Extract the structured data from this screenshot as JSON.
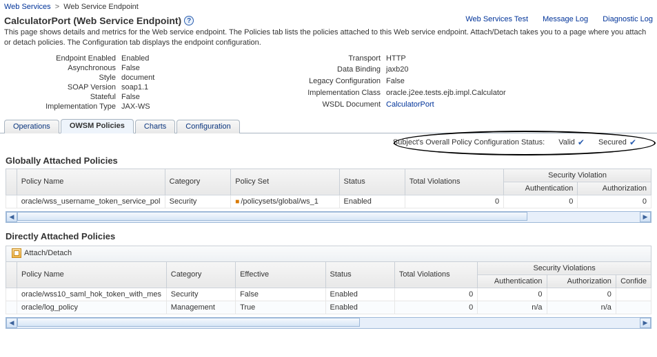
{
  "breadcrumb": {
    "root": "Web Services",
    "current": "Web Service Endpoint"
  },
  "title": "CalculatorPort (Web Service Endpoint)",
  "actions": {
    "test": "Web Services Test",
    "log": "Message Log",
    "diag": "Diagnostic Log"
  },
  "description": "This page shows details and metrics for the Web service endpoint. The Policies tab lists the policies attached to this Web service endpoint. Attach/Detach takes you to a page where you attach or detach policies. The Configuration tab displays the endpoint configuration.",
  "props_left": {
    "endpoint_enabled": {
      "label": "Endpoint Enabled",
      "value": "Enabled"
    },
    "asynchronous": {
      "label": "Asynchronous",
      "value": "False"
    },
    "style": {
      "label": "Style",
      "value": "document"
    },
    "soap_version": {
      "label": "SOAP Version",
      "value": "soap1.1"
    },
    "stateful": {
      "label": "Stateful",
      "value": "False"
    },
    "impl_type": {
      "label": "Implementation Type",
      "value": "JAX-WS"
    }
  },
  "props_right": {
    "transport": {
      "label": "Transport",
      "value": "HTTP"
    },
    "data_binding": {
      "label": "Data Binding",
      "value": "jaxb20"
    },
    "legacy_config": {
      "label": "Legacy Configuration",
      "value": "False"
    },
    "impl_class": {
      "label": "Implementation Class",
      "value": "oracle.j2ee.tests.ejb.impl.Calculator"
    },
    "wsdl_document": {
      "label": "WSDL Document",
      "value": "CalculatorPort"
    }
  },
  "tabs": {
    "operations": "Operations",
    "owsm": "OWSM Policies",
    "charts": "Charts",
    "config": "Configuration"
  },
  "status_bar": {
    "label": "Subject's Overall Policy Configuration Status:",
    "valid": "Valid",
    "secured": "Secured"
  },
  "sections": {
    "global": "Globally Attached Policies",
    "direct": "Directly Attached Policies"
  },
  "toolbar": {
    "attach": "Attach/Detach"
  },
  "global_headers": {
    "policy_name": "Policy Name",
    "category": "Category",
    "policy_set": "Policy Set",
    "status": "Status",
    "total_violations": "Total Violations",
    "security_group": "Security Violation",
    "authentication": "Authentication",
    "authorization": "Authorization"
  },
  "global_rows": [
    {
      "policy_name": "oracle/wss_username_token_service_pol",
      "category": "Security",
      "policy_set": "/policysets/global/ws_1",
      "status": "Enabled",
      "total_violations": "0",
      "authentication": "0",
      "authorization": "0"
    }
  ],
  "direct_headers": {
    "policy_name": "Policy Name",
    "category": "Category",
    "effective": "Effective",
    "status": "Status",
    "total_violations": "Total Violations",
    "security_group": "Security Violations",
    "authentication": "Authentication",
    "authorization": "Authorization",
    "confidentiality": "Confide"
  },
  "direct_rows": [
    {
      "policy_name": "oracle/wss10_saml_hok_token_with_mes",
      "category": "Security",
      "effective": "False",
      "status": "Enabled",
      "total_violations": "0",
      "authentication": "0",
      "authorization": "0",
      "confidentiality": ""
    },
    {
      "policy_name": "oracle/log_policy",
      "category": "Management",
      "effective": "True",
      "status": "Enabled",
      "total_violations": "0",
      "authentication": "n/a",
      "authorization": "n/a",
      "confidentiality": ""
    }
  ]
}
